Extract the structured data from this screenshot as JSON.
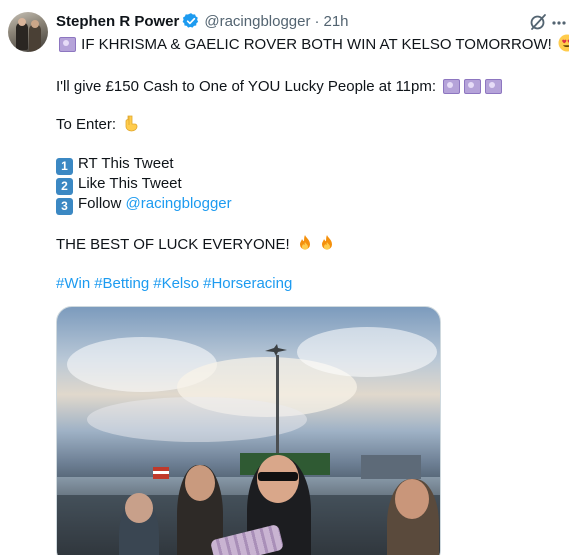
{
  "tweet": {
    "author": {
      "display_name": "Stephen R Power",
      "handle": "@racingblogger",
      "separator": "·",
      "time": "21h",
      "verified": true
    },
    "line1_text": " IF KHRISMA & GAELIC ROVER BOTH WIN AT KELSO TOMORROW! ",
    "line2_text": "I'll give £150 Cash to One of YOU Lucky People at 11pm: ",
    "line3_text": "To Enter: ",
    "steps": [
      {
        "number": "1",
        "text": "RT This Tweet"
      },
      {
        "number": "2",
        "text": "Like This Tweet"
      },
      {
        "number": "3",
        "text": "Follow ",
        "mention": "@racingblogger"
      }
    ],
    "closing_text": "THE BEST OF LUCK EVERYONE! ",
    "hashtags": [
      "#Win",
      "#Betting",
      "#Kelso",
      "#Horseracing"
    ],
    "icons": {
      "verified": "verified-badge-icon",
      "grok": "grok-icon",
      "more": "more-options-icon",
      "money": "money-with-wings-emoji",
      "heart_eyes": "heart-eyes-emoji",
      "point_down": "point-down-emoji",
      "fire": "fire-emoji"
    },
    "colors": {
      "text": "#0f1419",
      "secondary": "#536471",
      "link": "#1d9bf0",
      "verified": "#1d9bf0",
      "keycap": "#3b88c3"
    }
  }
}
